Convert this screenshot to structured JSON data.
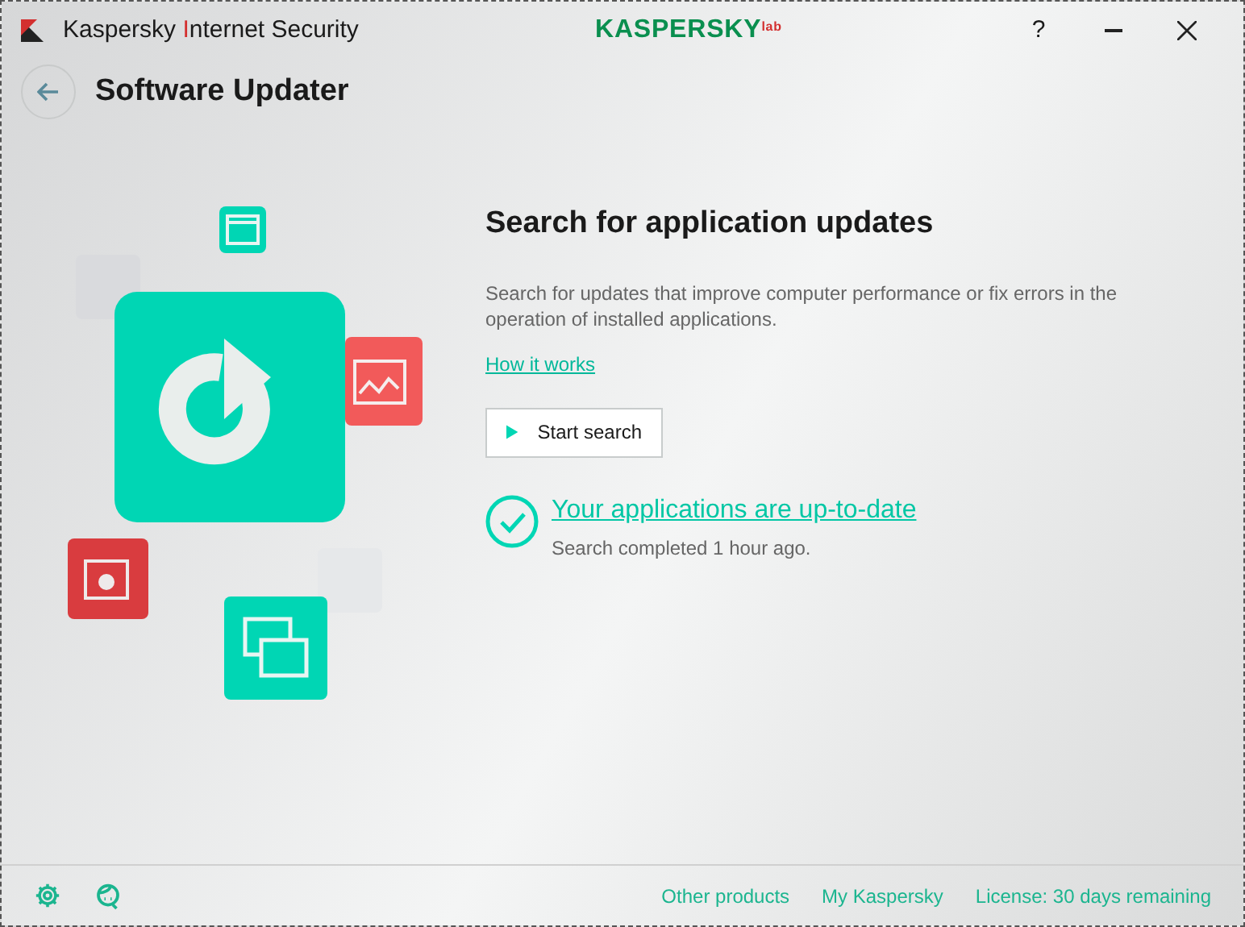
{
  "window": {
    "title_parts": [
      "Kaspersky ",
      "I",
      "nternet Security"
    ],
    "logo": "KASPERSKY",
    "logo_suffix": "lab",
    "controls": [
      "?"
    ]
  },
  "header": {
    "title": "Software Updater"
  },
  "main": {
    "heading": "Search for application updates",
    "description": "Search for updates that improve computer performance or fix errors in the operation of installed applications.",
    "link": "How it works",
    "button": "Start search",
    "status": {
      "title": "Your applications are up-to-date",
      "subtitle": "Search completed 1 hour ago."
    }
  },
  "footer": {
    "links": [
      "Other products",
      "My Kaspersky",
      "License: 30 days remaining"
    ]
  }
}
